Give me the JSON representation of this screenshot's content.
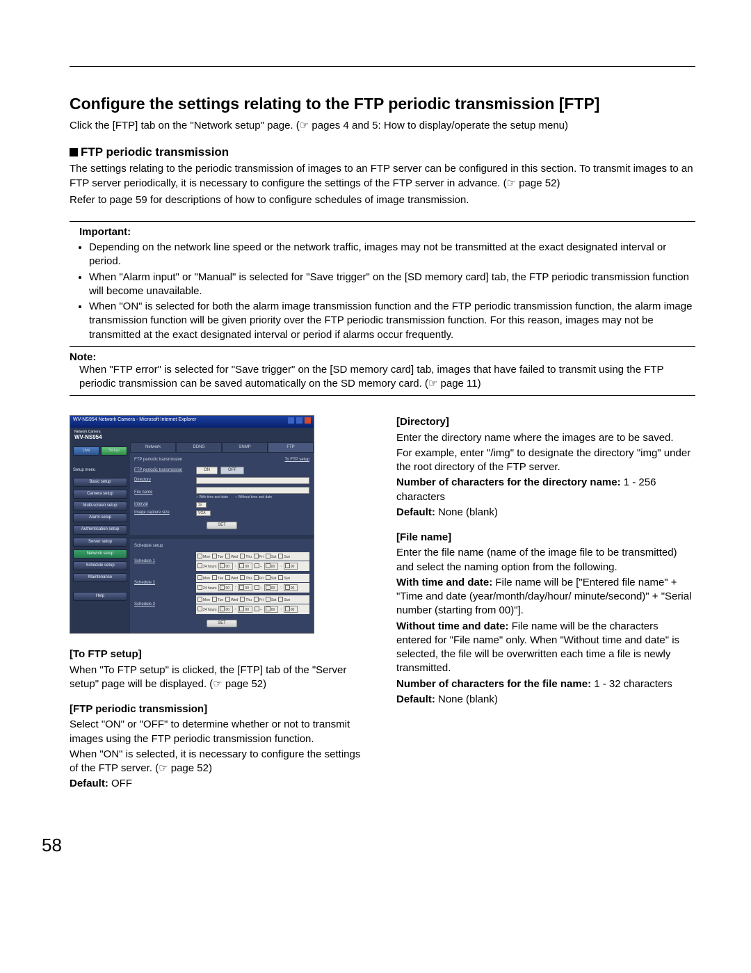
{
  "page": {
    "title": "Configure the settings relating to the FTP periodic transmission [FTP]",
    "under_title_1": "Click the [FTP] tab on the \"Network setup\" page. (",
    "under_title_ref": "☞",
    "under_title_2": " pages 4 and 5: How to display/operate the setup menu)",
    "sub_heading": "FTP periodic transmission",
    "para1": "The settings relating to the periodic transmission of images to an FTP server can be configured in this section. To transmit images to an FTP server periodically, it is necessary to configure the settings of the FTP server in advance. (",
    "para1_ref": "☞",
    "para1_tail": " page 52)",
    "para2": "Refer to page 59 for descriptions of how to configure schedules of image transmission.",
    "important_label": "Important:",
    "bullets": [
      "Depending on the network line speed or the network traffic, images may not be transmitted at the exact designated interval or period.",
      "When \"Alarm input\" or \"Manual\" is selected for \"Save trigger\" on the [SD memory card] tab, the FTP periodic transmission function will become unavailable.",
      "When \"ON\" is selected for both the alarm image transmission function and the FTP periodic transmission function, the alarm image transmission function will be given priority over the FTP periodic transmission function. For this reason, images may not be transmitted at the exact designated interval or period if alarms occur frequently."
    ],
    "note_label": "Note:",
    "note_body_1": "When \"FTP error\" is selected for \"Save trigger\" on the [SD memory card] tab, images that have failed to transmit using the FTP periodic transmission can be saved automatically on the SD memory card. (",
    "note_ref": "☞",
    "note_body_2": " page 11)",
    "page_number": "58"
  },
  "left": {
    "h_to_ftp": "[To FTP setup]",
    "to_ftp_body_1": "When \"To FTP setup\" is clicked, the [FTP] tab of the \"Server setup\" page will be displayed. (",
    "to_ftp_ref": "☞",
    "to_ftp_body_2": " page 52)",
    "h_ftp_pt": "[FTP periodic transmission]",
    "ftp_pt_body_1": "Select \"ON\" or \"OFF\" to determine whether or not to transmit images using the FTP periodic transmission function.",
    "ftp_pt_body_2a": "When \"ON\" is selected, it is necessary to configure the settings of the FTP server. (",
    "ftp_pt_ref": "☞",
    "ftp_pt_body_2b": " page 52)",
    "default_label": "Default:",
    "default_value": " OFF"
  },
  "right": {
    "h_dir": "[Directory]",
    "dir_p1": "Enter the directory name where the images are to be saved.",
    "dir_p2": "For example, enter \"/img\" to designate the directory \"img\" under the root directory of the FTP server.",
    "dir_nchars_label": "Number of characters for the directory name:",
    "dir_nchars_value": " 1 - 256 characters",
    "dir_default_label": "Default:",
    "dir_default_value": " None (blank)",
    "h_file": "[File name]",
    "file_p1": "Enter the file name (name of the image file to be transmitted) and select the naming option from the following.",
    "wtd_label": "With time and date:",
    "wtd_value": " File name will be [\"Entered file name\" + \"Time and date (year/month/day/hour/ minute/second)\" + \"Serial number (starting from 00)\"].",
    "wotd_label": "Without time and date:",
    "wotd_value": " File name will be the characters entered for \"File name\" only. When \"Without time and date\" is selected, the file will be overwritten each time a file is newly transmitted.",
    "file_nchars_label": "Number of characters for the file name:",
    "file_nchars_value": " 1 - 32 characters",
    "file_default_label": "Default:",
    "file_default_value": " None (blank)"
  },
  "app": {
    "titlebar": "WV-NS954 Network Camera - Microsoft Internet Explorer",
    "header_sub": "Network Camera",
    "header_model": "WV-NS954",
    "live": "Live",
    "setup": "Setup",
    "sidebar_title": "Setup menu",
    "sidebar": [
      "Basic setup",
      "Camera setup",
      "Multi-screen setup",
      "Alarm setup",
      "Authentication setup",
      "Server setup",
      "Network setup",
      "Schedule setup",
      "Maintenance",
      "Help"
    ],
    "tabs": [
      "Network",
      "DDNS",
      "SNMP",
      "FTP"
    ],
    "section1": "FTP periodic transmission",
    "to_ftp": "To FTP setup",
    "row_ftp_pt": "FTP periodic transmission",
    "on": "ON",
    "off": "OFF",
    "row_dir": "Directory",
    "row_file": "File name",
    "with_td": "With time and date",
    "without_td": "Without time and date",
    "row_interval": "Interval",
    "interval_val": "1s",
    "row_ics": "Image capture size",
    "ics_val": "VGA",
    "set": "SET",
    "section2": "Schedule setup",
    "sched_labels": [
      "Schedule 1",
      "Schedule 2",
      "Schedule 3"
    ],
    "days": [
      "Mon",
      "Tue",
      "Wed",
      "Thu",
      "Fri",
      "Sat",
      "Sun"
    ],
    "all24": "24 hours",
    "hh": "00",
    "dash": "–"
  }
}
